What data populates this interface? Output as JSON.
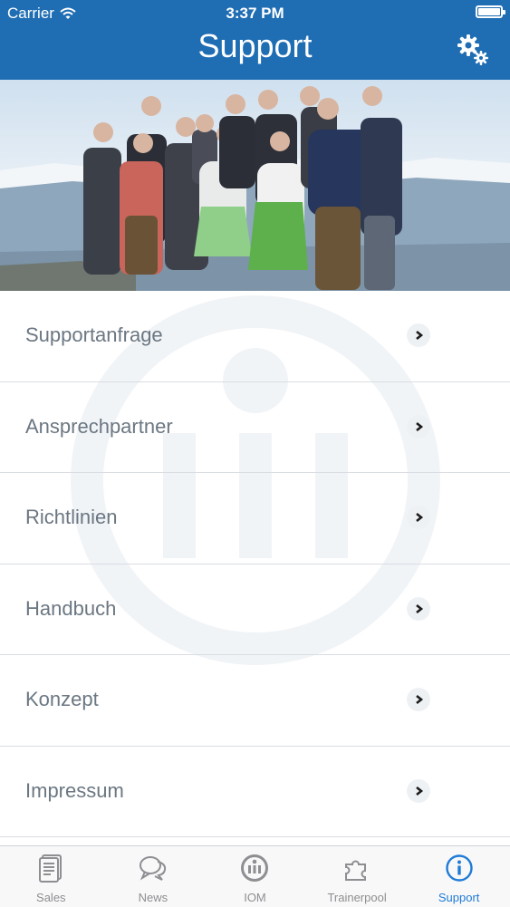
{
  "status_bar": {
    "carrier": "Carrier",
    "time": "3:37 PM"
  },
  "header": {
    "title": "Support",
    "settings_icon": "gear-icon"
  },
  "menu": {
    "items": [
      {
        "label": "Supportanfrage"
      },
      {
        "label": "Ansprechpartner"
      },
      {
        "label": "Richtlinien"
      },
      {
        "label": "Handbuch"
      },
      {
        "label": "Konzept"
      },
      {
        "label": "Impressum"
      }
    ]
  },
  "tabbar": {
    "tabs": [
      {
        "label": "Sales",
        "icon": "document-icon",
        "active": false
      },
      {
        "label": "News",
        "icon": "chat-bubbles-icon",
        "active": false
      },
      {
        "label": "IOM",
        "icon": "iom-logo-icon",
        "active": false
      },
      {
        "label": "Trainerpool",
        "icon": "puzzle-icon",
        "active": false
      },
      {
        "label": "Support",
        "icon": "info-icon",
        "active": true
      }
    ]
  },
  "colors": {
    "header_bg": "#1f6db3",
    "active_tab": "#1f7bd8",
    "inactive_tab": "#8e8e93",
    "menu_text": "#6b7782"
  }
}
